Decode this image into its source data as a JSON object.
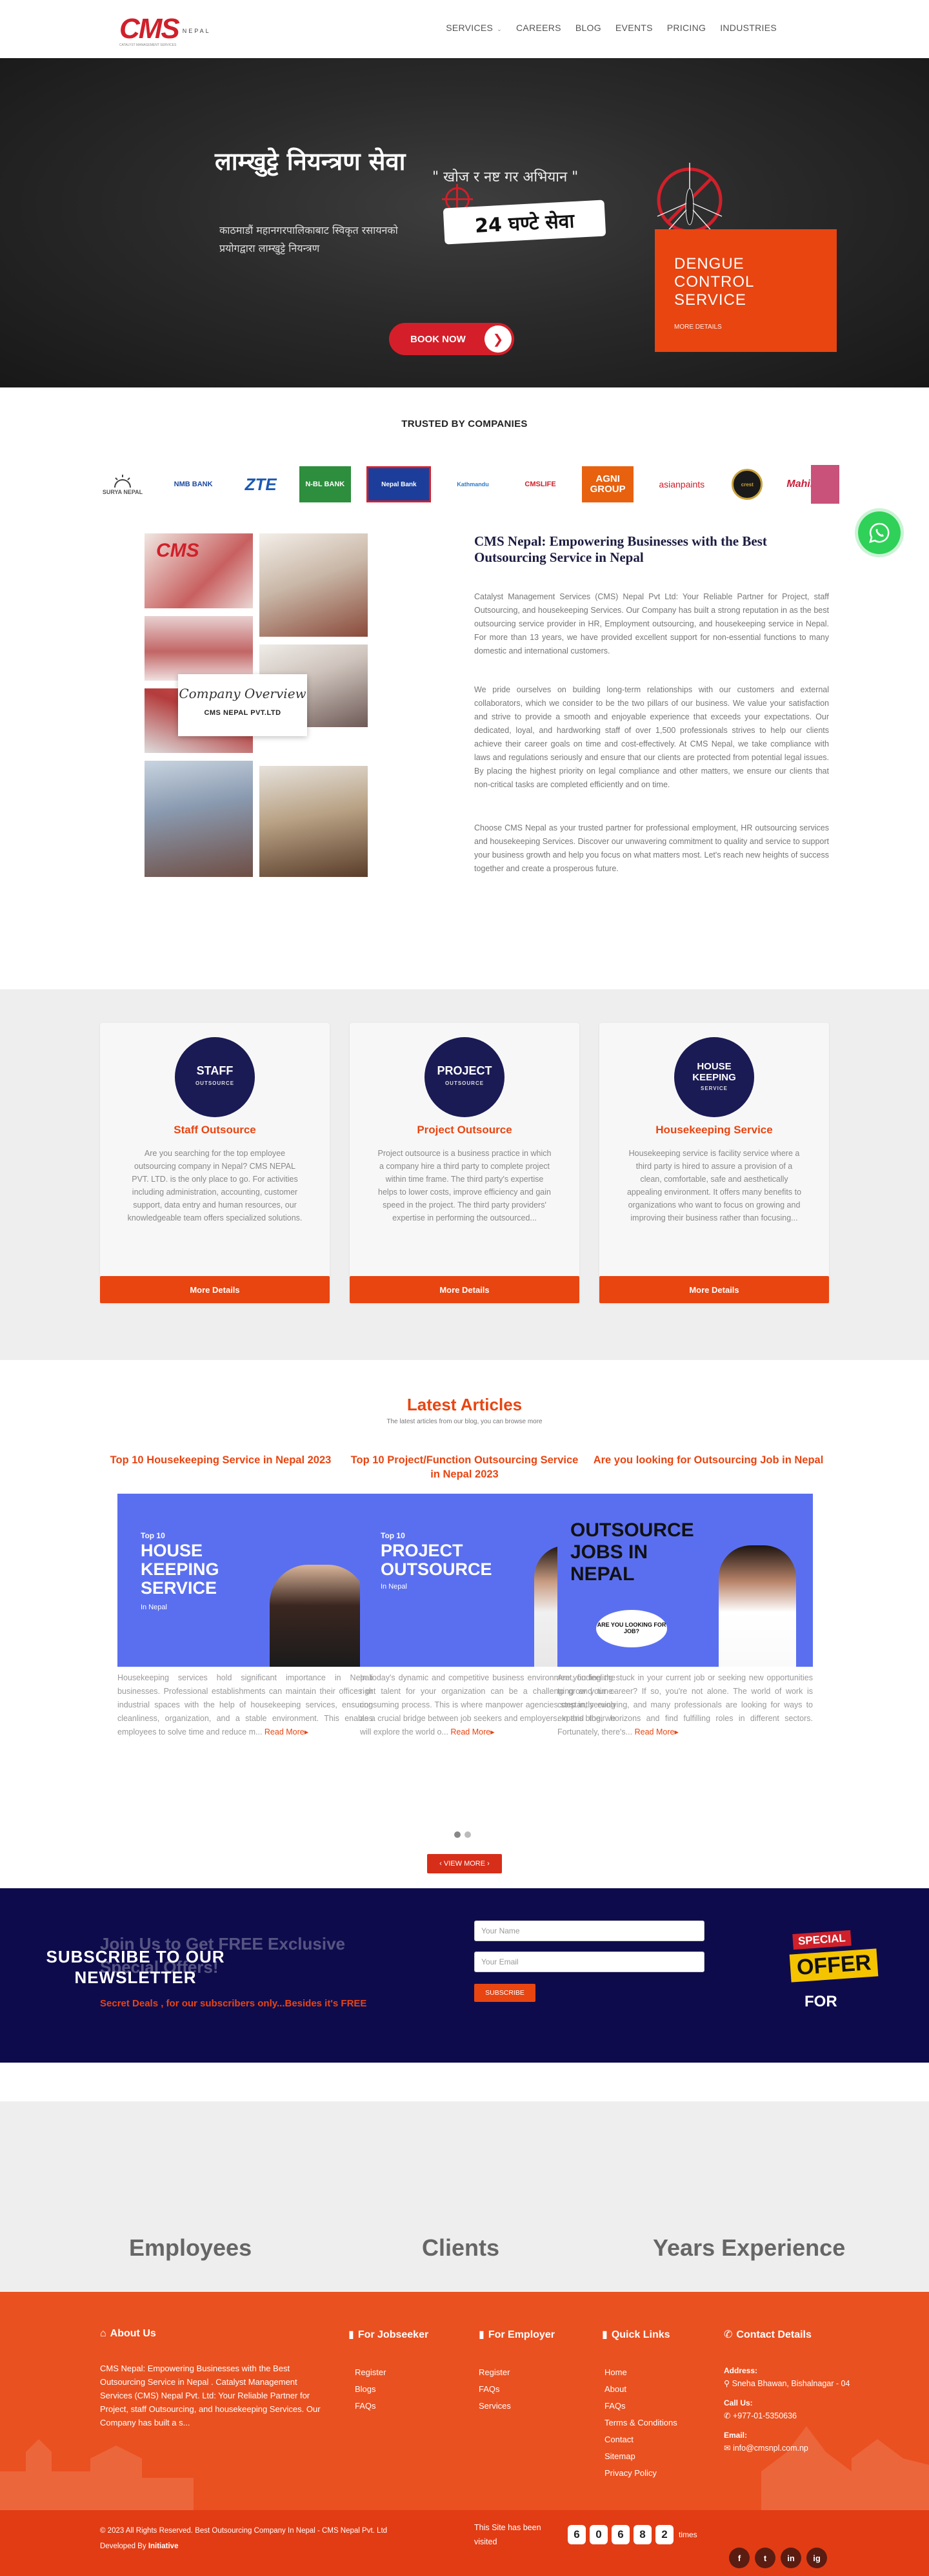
{
  "header": {
    "logo_text": "CMS",
    "logo_sub": "NEPAL",
    "logo_tagline": "CATALYST MANAGEMENT SERVICES",
    "nav": [
      {
        "label": "SERVICES",
        "has_dropdown": true
      },
      {
        "label": "CAREERS"
      },
      {
        "label": "BLOG"
      },
      {
        "label": "EVENTS"
      },
      {
        "label": "PRICING"
      },
      {
        "label": "INDUSTRIES"
      }
    ]
  },
  "hero": {
    "title": "लाम्खुट्टे नियन्त्रण सेवा",
    "subtitle": "काठमाडौं महानगरपालिकाबाट स्विकृत रसायनको प्रयोगद्वारा लाम्खुट्टे नियन्त्रण",
    "quote": "\" खोज र नष्ट गर अभियान \"",
    "badge": "24 घण्टे सेवा",
    "book_button": "BOOK NOW",
    "dengue_title": "DENGUE CONTROL SERVICE",
    "dengue_more": "MORE DETAILS"
  },
  "trusted": {
    "title": "TRUSTED BY COMPANIES",
    "logos": [
      {
        "name": "SURYA NEPAL",
        "color": "#6a6a6a"
      },
      {
        "name": "NMB BANK",
        "color": "#1c4aa0"
      },
      {
        "name": "ZTE",
        "color": "#1b58b6"
      },
      {
        "name": "N-BL BANK",
        "color": "#ffffff"
      },
      {
        "name": "Nepal Bank",
        "color": "#ffffff"
      },
      {
        "name": "Kathmandu",
        "color": "#2b7bc9"
      },
      {
        "name": "CMSLIFE",
        "color": "#d0202a"
      },
      {
        "name": "AGNI GROUP",
        "color": "#ffffff"
      },
      {
        "name": "asianpaints",
        "color": "#d0202a"
      },
      {
        "name": "crest",
        "color": "#c9a23a"
      },
      {
        "name": "Mahindra",
        "color": "#c81e3a"
      }
    ]
  },
  "about": {
    "overview_script": "Company Overview",
    "overview_name": "CMS NEPAL PVT.LTD",
    "title": "CMS Nepal: Empowering Businesses with the Best Outsourcing Service in Nepal",
    "para1": "Catalyst Management Services (CMS) Nepal Pvt Ltd: Your Reliable Partner for Project, staff Outsourcing, and housekeeping Services. Our Company has built a strong reputation in as the best outsourcing service provider in HR, Employment outsourcing, and housekeeping service in Nepal. For more than 13 years, we have provided excellent support for non-essential functions to many domestic and international customers.",
    "para2": "We pride ourselves on building long-term relationships with our customers and external collaborators, which we consider to be the two pillars of our business. We value your satisfaction and strive to provide a smooth and enjoyable experience that exceeds your expectations. Our dedicated, loyal, and hardworking staff of over 1,500 professionals strives to help our clients achieve their career goals on time and cost-effectively. At CMS Nepal, we take compliance with laws and regulations seriously and ensure that our clients are protected from potential legal issues. By placing the highest priority on legal compliance and other matters, we ensure our clients that non-critical tasks are completed efficiently and on time.",
    "para3": "Choose CMS Nepal as your trusted partner for professional employment, HR outsourcing services and housekeeping Services. Discover our unwavering commitment to quality and service to support your business growth and help you focus on what matters most. Let's reach new heights of success together and create a prosperous future."
  },
  "services": [
    {
      "circle_line1": "STAFF",
      "circle_line2": "OUTSOURCE",
      "title": "Staff Outsource",
      "desc": "Are you searching for the top employee outsourcing company in Nepal? CMS NEPAL PVT. LTD. is the only place to go. For activities including administration, accounting, customer support, data entry and human resources, our knowledgeable team offers specialized solutions.",
      "button": "More Details"
    },
    {
      "circle_line1": "PROJECT",
      "circle_line2": "OUTSOURCE",
      "title": "Project Outsource",
      "desc": "Project outsource is a business practice in which a company hire a third party to complete project within time frame. The third party's expertise helps to lower costs, improve efficiency and gain speed in the project. The third party providers' expertise in performing the outsourced...",
      "button": "More Details"
    },
    {
      "circle_line1": "HOUSE KEEPING",
      "circle_line2": "SERVICE",
      "title": "Housekeeping Service",
      "desc": "Housekeeping service is facility service where a third party is hired to assure a provision of a clean, comfortable, safe and aesthetically appealing environment. It offers many benefits to organizations who want to focus on growing and improving their business rather than focusing...",
      "button": "More Details"
    }
  ],
  "articles": {
    "heading": "Latest Articles",
    "subheading": "The latest articles from our blog, you can browse more",
    "items": [
      {
        "title": "Top 10 Housekeeping Service in Nepal 2023",
        "img_small": "Top 10",
        "img_big": "HOUSE KEEPING SERVICE",
        "img_tail": "In Nepal",
        "text": "Housekeeping services hold significant importance in Nepali businesses. Professional establishments can maintain their offices or industrial spaces with the help of housekeeping services, ensuring cleanliness, organization, and a stable environment. This enables employees to solve time and reduce m...",
        "read_more": "Read More"
      },
      {
        "title": "Top 10 Project/Function Outsourcing Service in Nepal 2023",
        "img_small": "Top 10",
        "img_big": "PROJECT OUTSOURCE",
        "img_tail": "In Nepal",
        "text": "In today's dynamic and competitive business environment, finding the right talent for your organization can be a challenging and time-consuming process. This is where manpower agencies step in, serving as a crucial bridge between job seekers and employers. In this blog, we will explore the world o...",
        "read_more": "Read More"
      },
      {
        "title": "Are you looking for Outsourcing Job in Nepal",
        "img_small": "",
        "img_big": "OUTSOURCE JOBS IN NEPAL",
        "img_tail": "ARE YOU LOOKING FOR JOB?",
        "text": "Are you feeling stuck in your current job or seeking new opportunities to grow your career? If so, you're not alone. The world of work is constantly evolving, and many professionals are looking for ways to expand their horizons and find fulfilling roles in different sectors. Fortunately, there's...",
        "read_more": "Read More"
      }
    ],
    "view_more": "VIEW MORE"
  },
  "subscribe": {
    "ghost_text": "Join Us to Get FREE Exclusive Special Offers!",
    "big_text": "SUBSCRIBE TO OUR NEWSLETTER",
    "deal_text": "Secret Deals , for our subscribers only...Besides it's FREE",
    "name_placeholder": "Your Name",
    "email_placeholder": "Your Email",
    "button": "SUBSCRIBE",
    "offer_top": "SPECIAL",
    "offer_mid": "OFFER",
    "offer_bottom": "FOR"
  },
  "stats": {
    "employees": "Employees",
    "clients": "Clients",
    "years": "Years Experience"
  },
  "footer": {
    "about_h": "About Us",
    "about_text": "CMS Nepal: Empowering Businesses with the Best Outsourcing Service in Nepal . Catalyst Management Services (CMS) Nepal Pvt. Ltd: Your Reliable Partner for Project, staff Outsourcing, and housekeeping Services. Our Company has built a s...",
    "jobseeker_h": "For Jobseeker",
    "jobseeker_links": [
      "Register",
      "Blogs",
      "FAQs"
    ],
    "employer_h": "For Employer",
    "employer_links": [
      "Register",
      "FAQs",
      "Services"
    ],
    "quick_h": "Quick Links",
    "quick_links": [
      "Home",
      "About",
      "FAQs",
      "Terms & Conditions",
      "Contact",
      "Sitemap",
      "Privacy Policy"
    ],
    "contact_h": "Contact Details",
    "address_label": "Address:",
    "address_value": "Sneha Bhawan, Bishalnagar - 04",
    "call_label": "Call Us:",
    "call_value": "+977-01-5350636",
    "email_label": "Email:",
    "email_value": "info@cmsnpl.com.np",
    "copyright": "© 2023 All Rights Reserved.  Best Outsourcing Company In Nepal - CMS Nepal Pvt. Ltd",
    "developed": "Developed By",
    "developer": "Initiative",
    "visited": "This Site has been visited",
    "counter_digits": [
      "6",
      "0",
      "6",
      "8",
      "2"
    ],
    "times": "times",
    "socials": [
      "f",
      "t",
      "in",
      "ig"
    ]
  }
}
